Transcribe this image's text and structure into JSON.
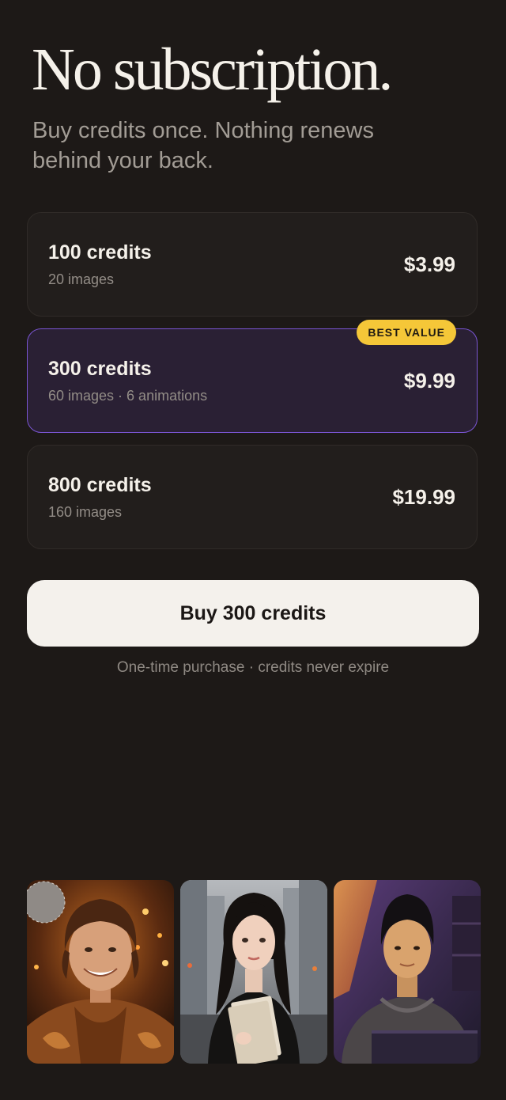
{
  "header": {
    "title": "No subscription.",
    "subtitle_line1": "Buy credits once. Nothing renews",
    "subtitle_line2": "behind your back."
  },
  "plans": [
    {
      "title": "100 credits",
      "subtitle": "20 images",
      "price": "$3.99",
      "selected": false
    },
    {
      "title": "300 credits",
      "subtitle": "60 images · 6 animations",
      "price": "$9.99",
      "selected": true,
      "badge": "BEST VALUE"
    },
    {
      "title": "800 credits",
      "subtitle": "160 images",
      "price": "$19.99",
      "selected": false
    }
  ],
  "cta": {
    "label": "Buy 300 credits",
    "footnote": "One-time purchase · credits never expire"
  },
  "colors": {
    "background": "#1d1917",
    "card": "#221e1c",
    "selected_card": "#2a2034",
    "selected_border": "#7a55d3",
    "badge": "#f5c738",
    "button": "#f4f1ec"
  },
  "gallery": [
    {
      "icon": "portrait-man-disco-icon"
    },
    {
      "icon": "portrait-woman-city-icon"
    },
    {
      "icon": "portrait-man-laptop-icon"
    }
  ]
}
